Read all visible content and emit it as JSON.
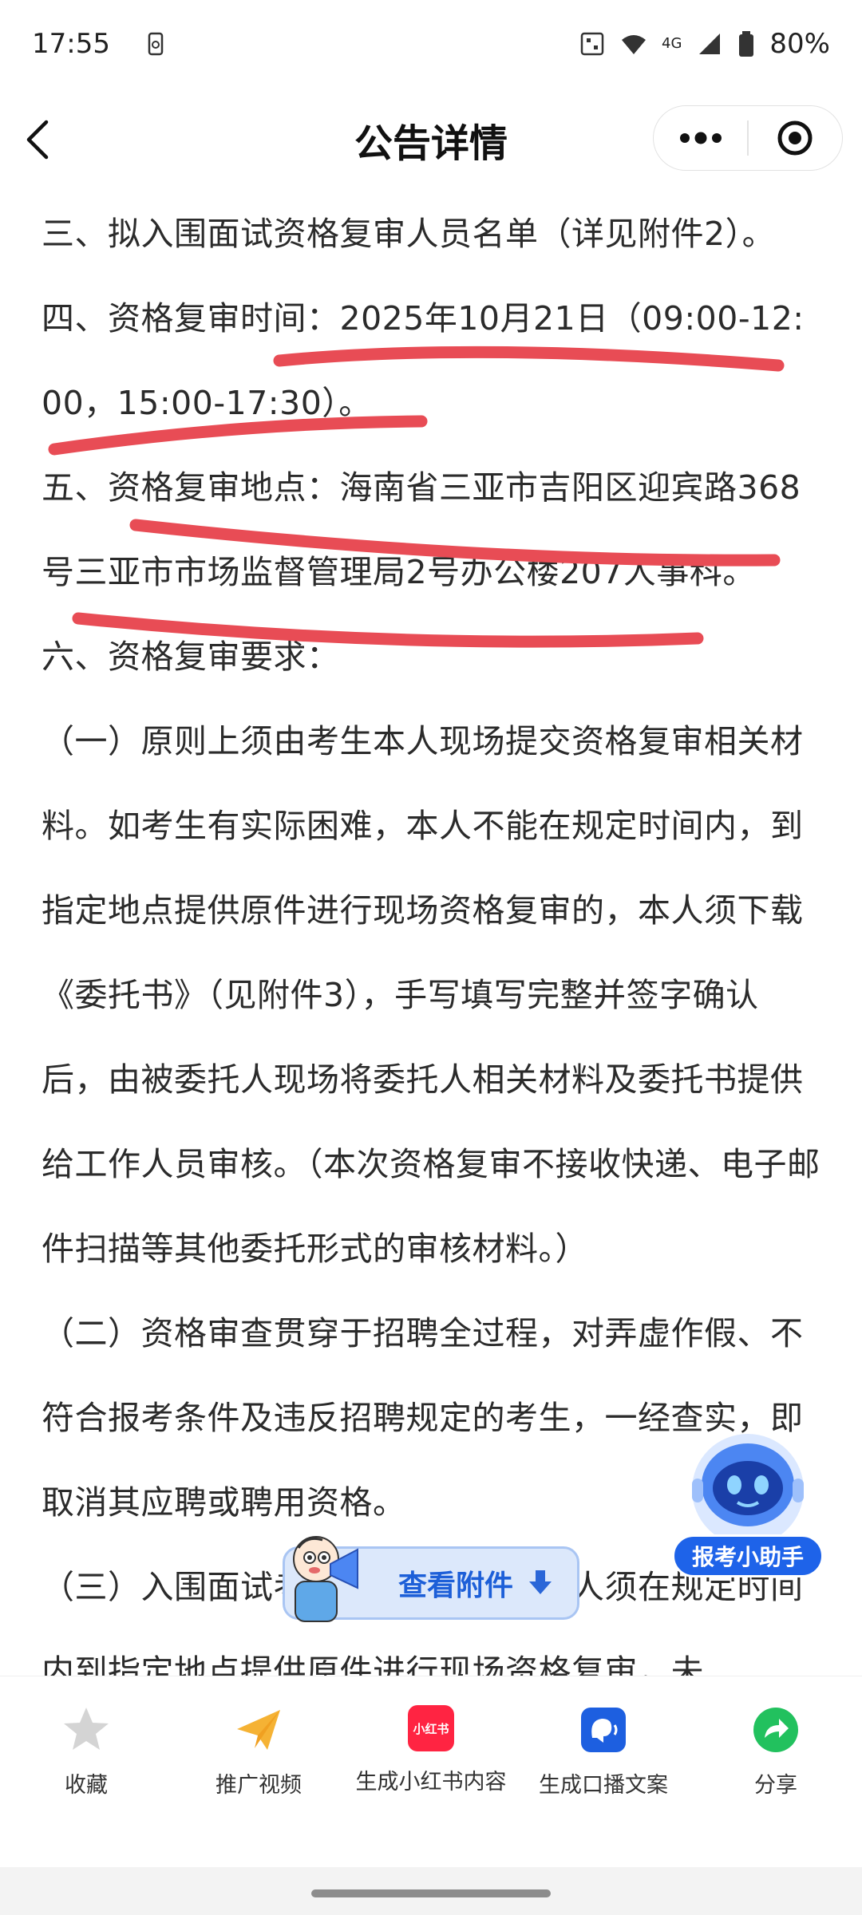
{
  "status": {
    "time": "17:55",
    "battery": "80%",
    "network": "4G"
  },
  "nav": {
    "title": "公告详情",
    "more_icon": "more-dots-icon",
    "target_icon": "target-icon"
  },
  "article": {
    "paragraphs": [
      "三、拟入围面试资格复审人员名单（详见附件2）。",
      "四、资格复审时间：2025年10月21日（09:00-12:00，15:00-17:30）。",
      "五、资格复审地点：海南省三亚市吉阳区迎宾路368号三亚市市场监督管理局2号办公楼207人事科。",
      "六、资格复审要求：",
      "（一）原则上须由考生本人现场提交资格复审相关材料。如考生有实际困难，本人不能在规定时间内，到指定地点提供原件进行现场资格复审的，本人须下载《委托书》（见附件3），手写填写完整并签字确认后，由被委托人现场将委托人相关材料及委托书提供给工作人员审核。（本次资格复审不接收快递、电子邮件扫描等其他委托形式的审核材料。）",
      "（二）资格审查贯穿于招聘全过程，对弄虚作假、不符合报考条件及违反招聘规定的考生，一经查实，即取消其应聘或聘用资格。",
      "（三）入围面试考生本人或相应委托人须在规定时间内到指定地点提供原件进行现场资格复审，未"
    ],
    "underline_color": "#e84c55"
  },
  "assistant": {
    "label": "报考小助手"
  },
  "attachment": {
    "label": "查看附件"
  },
  "toolbar": {
    "items": [
      {
        "label": "收藏",
        "icon": "star-icon"
      },
      {
        "label": "推广视频",
        "icon": "paper-plane-icon"
      },
      {
        "label": "生成小红书内容",
        "icon": "xiaohongshu-icon",
        "badge": "小红书"
      },
      {
        "label": "生成口播文案",
        "icon": "voice-speaker-icon"
      },
      {
        "label": "分享",
        "icon": "share-icon"
      }
    ]
  }
}
